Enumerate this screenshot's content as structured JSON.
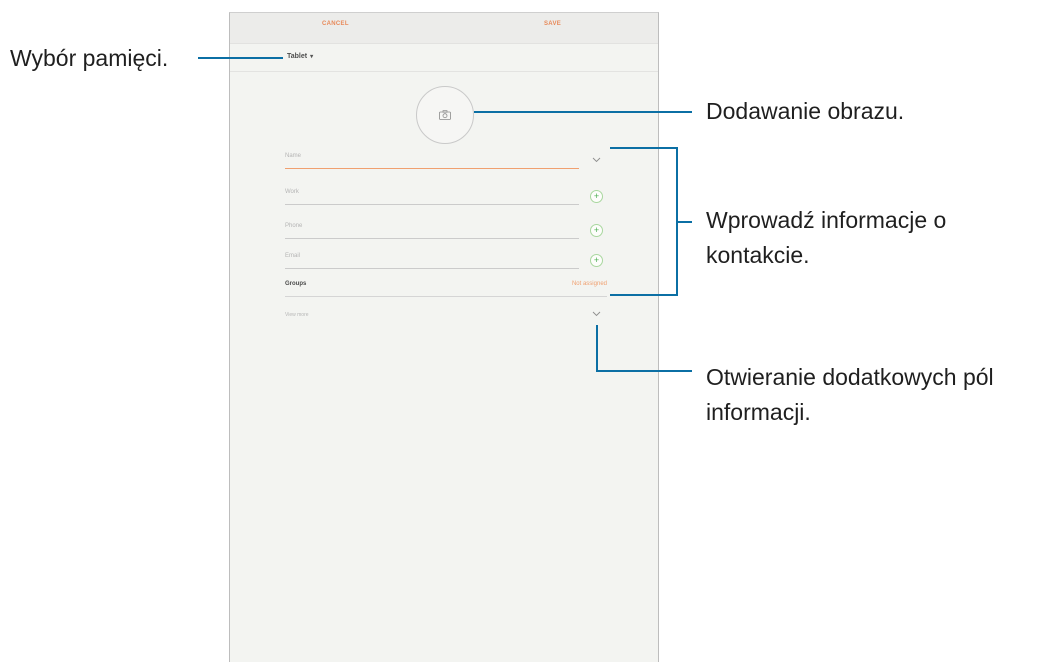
{
  "topbar": {
    "cancel_label": "CANCEL",
    "save_label": "SAVE"
  },
  "storage": {
    "label": "Tablet"
  },
  "form": {
    "name_label": "Name",
    "work_label": "Work",
    "phone_label": "Phone",
    "email_label": "Email",
    "groups_label": "Groups",
    "groups_value": "Not assigned",
    "view_more_label": "View more"
  },
  "callouts": {
    "storage": "Wybór pamięci.",
    "photo": "Dodawanie obrazu.",
    "info": "Wprowadź informacje o kontakcie.",
    "more": "Otwieranie dodatkowych pól informacji."
  },
  "colors": {
    "accent": "#f0a070",
    "leader": "#0b6fa4",
    "plus": "#4caf50"
  },
  "icons": {
    "photo": "camera-icon",
    "plus": "add-icon",
    "expand": "chevron-down-icon",
    "dropdown": "caret-down-icon"
  }
}
